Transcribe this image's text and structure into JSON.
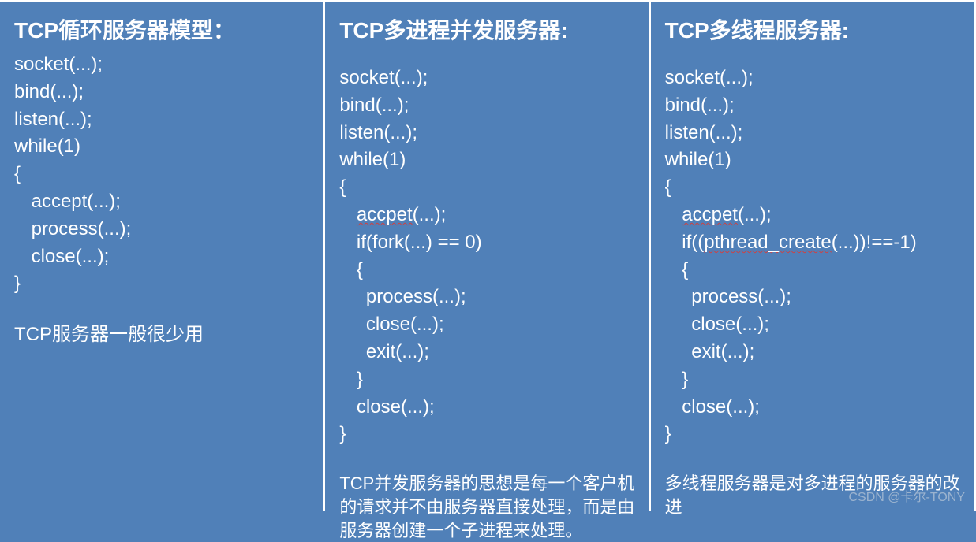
{
  "columns": {
    "col1": {
      "title": "TCP循环服务器模型：",
      "lines": {
        "l0": "socket(...);",
        "l1": "bind(...);",
        "l2": "listen(...);",
        "l3": "while(1)",
        "l4": "{",
        "l5": "accept(...);",
        "l6": "process(...);",
        "l7": "close(...);",
        "l8": "}"
      },
      "note": "TCP服务器一般很少用"
    },
    "col2": {
      "title": "TCP多进程并发服务器:",
      "lines": {
        "l0": "socket(...);",
        "l1": "bind(...);",
        "l2": "listen(...);",
        "l3": "while(1)",
        "l4": "{",
        "l5a": "accpet",
        "l5b": "(...);",
        "l6": "if(fork(...) == 0)",
        "l7": "{",
        "l8": "process(...);",
        "l9": "close(...);",
        "l10": "exit(...);",
        "l11": "}",
        "l12": "close(...);",
        "l13": "}"
      },
      "note": "TCP并发服务器的思想是每一个客户机的请求并不由服务器直接处理，而是由服务器创建一个子进程来处理。"
    },
    "col3": {
      "title": "TCP多线程服务器:",
      "lines": {
        "l0": "socket(...);",
        "l1": "bind(...);",
        "l2": "listen(...);",
        "l3": "while(1)",
        "l4": "{",
        "l5a": "accpet",
        "l5b": "(...);",
        "l6a": "if((",
        "l6b": "pthread_create",
        "l6c": "(...))!==-1)",
        "l7": "{",
        "l8": "process(...);",
        "l9": "close(...);",
        "l10": "exit(...);",
        "l11": "}",
        "l12": "close(...);",
        "l13": "}"
      },
      "note": "多线程服务器是对多进程的服务器的改进"
    }
  },
  "watermark": "CSDN @卡尔-TONY"
}
